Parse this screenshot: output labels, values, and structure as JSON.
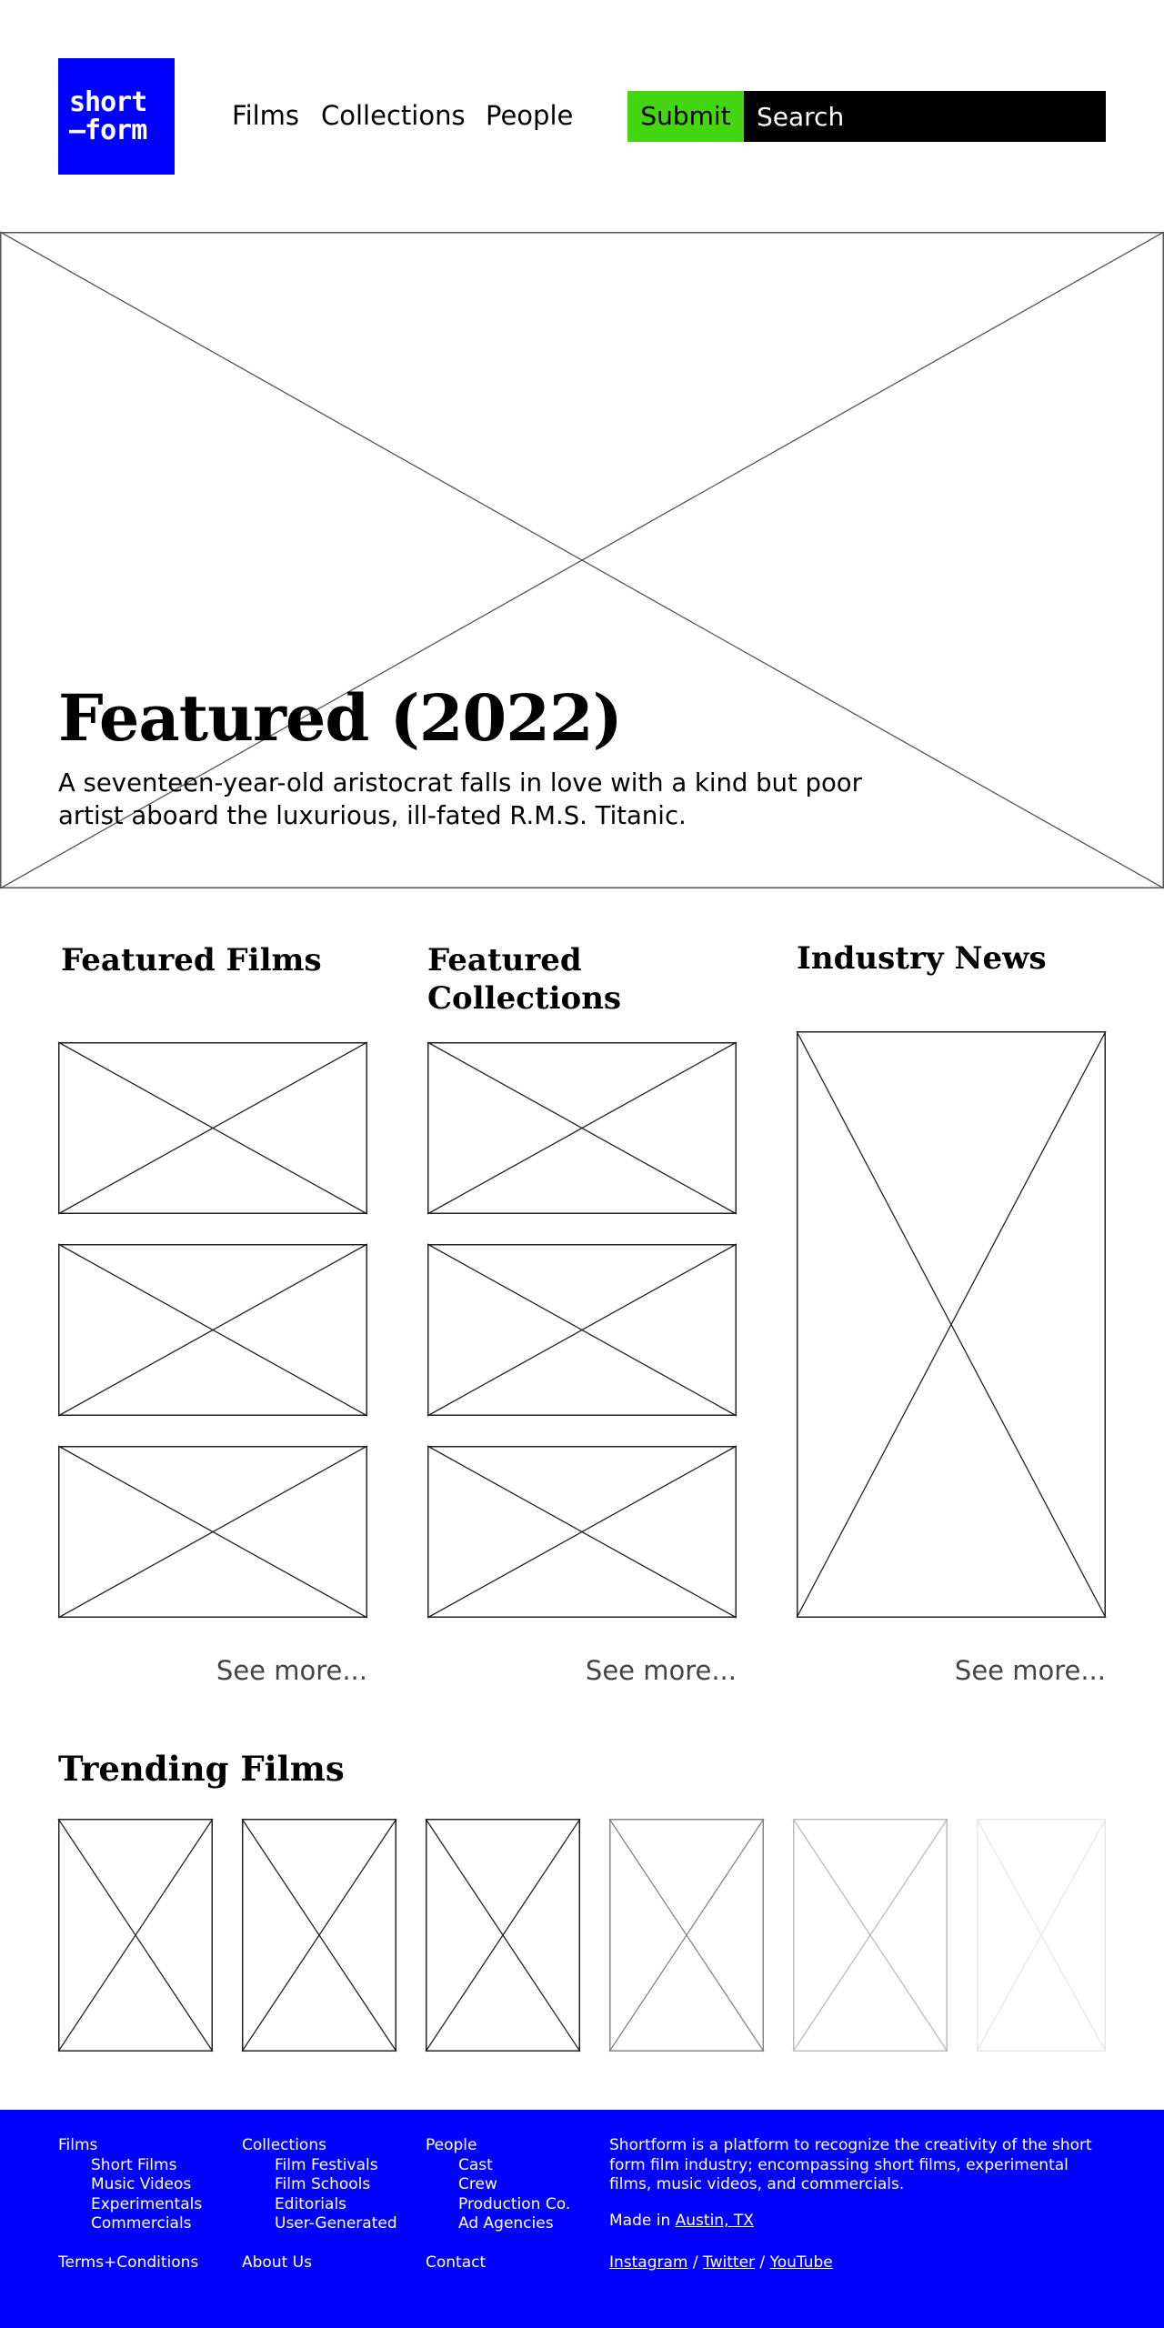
{
  "brand": {
    "logo_line1": "short",
    "logo_line2": "–form",
    "color": "#0000ff"
  },
  "nav": {
    "items": [
      "Films",
      "Collections",
      "People"
    ]
  },
  "header": {
    "submit_label": "Submit",
    "search_placeholder": "Search",
    "submit_color": "#44d611"
  },
  "hero": {
    "title": "Featured (2022)",
    "description": "A seventeen-year-old aristocrat falls in love with a kind but poor artist aboard the luxurious, ill-fated R.M.S. Titanic."
  },
  "sections": {
    "films": {
      "heading": "Featured Films",
      "see_more": "See more..."
    },
    "collections": {
      "heading": "Featured Collections",
      "see_more": "See more..."
    },
    "news": {
      "heading": "Industry News",
      "see_more": "See more..."
    }
  },
  "trending": {
    "heading": "Trending Films",
    "fade_levels": [
      1,
      1,
      1,
      0.55,
      0.3,
      0.1
    ]
  },
  "footer": {
    "columns": [
      {
        "title": "Films",
        "items": [
          "Short Films",
          "Music Videos",
          "Experimentals",
          "Commercials"
        ]
      },
      {
        "title": "Collections",
        "items": [
          "Film Festivals",
          "Film Schools",
          "Editorials",
          "User-Generated"
        ]
      },
      {
        "title": "People",
        "items": [
          "Cast",
          "Crew",
          "Production Co.",
          "Ad Agencies"
        ]
      }
    ],
    "about": "Shortform is a platform to recognize the creativity of the short form film industry; encompassing short films, experimental films, music videos, and commercials.",
    "made_prefix": "Made in ",
    "made_location": "Austin, TX",
    "bottom_links": [
      "Terms+Conditions",
      "About Us",
      "Contact"
    ],
    "social": [
      "Instagram",
      "Twitter",
      "YouTube"
    ],
    "social_separator": " / "
  }
}
